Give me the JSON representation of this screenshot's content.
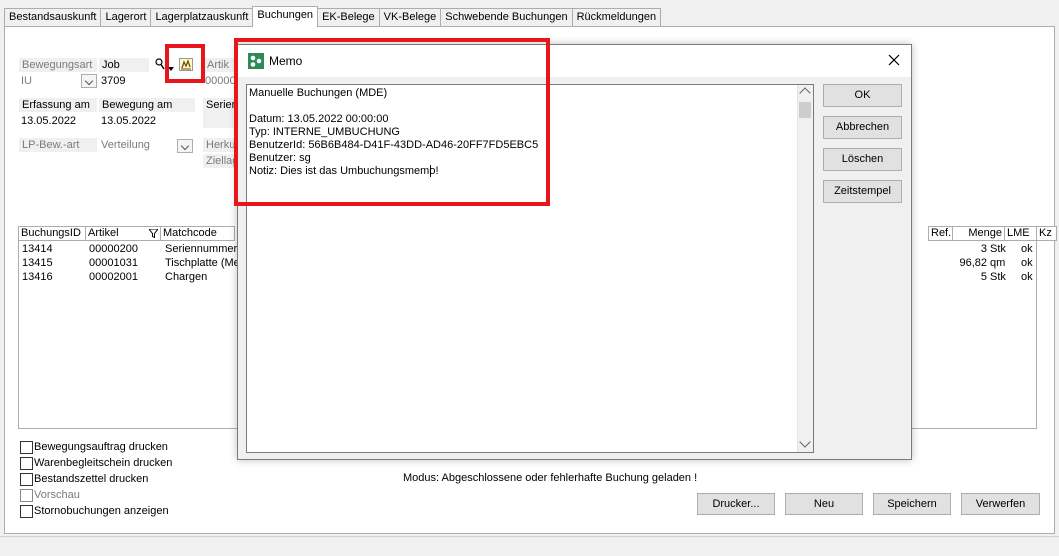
{
  "tabs": [
    "Bestandsauskunft",
    "Lagerort",
    "Lagerplatzauskunft",
    "Buchungen",
    "EK-Belege",
    "VK-Belege",
    "Schwebende Buchungen",
    "Rückmeldungen"
  ],
  "active_tab": "Buchungen",
  "form": {
    "bewegungsart_label": "Bewegungsart",
    "bewegungsart_value": "IU",
    "job_label": "Job",
    "job_value": "3709",
    "artikel_label": "Artik",
    "artikel_value": "00000",
    "erfassung_label": "Erfassung am",
    "erfassung_value": "13.05.2022",
    "bewegung_label": "Bewegung am",
    "bewegung_value": "13.05.2022",
    "serien_label": "Serien",
    "lpbew_label": "LP-Bew.-art",
    "lpbew_value": "Verteilung",
    "herkunft_label": "Herku",
    "ziellager_label": "Ziellag"
  },
  "table": {
    "headers": {
      "id": "BuchungsID",
      "artikel": "Artikel",
      "matchcode": "Matchcode",
      "ref": "Ref.",
      "menge": "Menge",
      "lme": "LME",
      "kz": "Kz"
    },
    "rows": [
      {
        "id": "13414",
        "artikel": "00000200",
        "matchcode": "Seriennummer",
        "menge": "3",
        "lme": "Stk",
        "kz": "ok"
      },
      {
        "id": "13415",
        "artikel": "00001031",
        "matchcode": "Tischplatte (Me",
        "menge": "96,82",
        "lme": "qm",
        "kz": "ok"
      },
      {
        "id": "13416",
        "artikel": "00002001",
        "matchcode": "Chargen",
        "menge": "5",
        "lme": "Stk",
        "kz": "ok"
      }
    ]
  },
  "checkboxes": [
    {
      "label": "Bewegungsauftrag drucken",
      "disabled": false
    },
    {
      "label": "Warenbegleitschein drucken",
      "disabled": false
    },
    {
      "label": "Bestandszettel drucken",
      "disabled": false
    },
    {
      "label": "Vorschau",
      "disabled": true
    },
    {
      "label": "Stornobuchungen anzeigen",
      "disabled": false
    }
  ],
  "modus_text": "Modus: Abgeschlossene oder fehlerhafte Buchung geladen !",
  "buttons": {
    "drucker": "Drucker...",
    "neu": "Neu",
    "speichern": "Speichern",
    "verwerfen": "Verwerfen"
  },
  "dialog": {
    "title": "Memo",
    "memo_lines": [
      "Manuelle Buchungen (MDE)",
      "",
      "Datum: 13.05.2022 00:00:00",
      "Typ: INTERNE_UMBUCHUNG",
      "BenutzerId: 56B6B484-D41F-43DD-AD46-20FF7FD5EBC5",
      "Benutzer: sg",
      "Notiz: Dies ist das Umbuchungsmemo!"
    ],
    "buttons": {
      "ok": "OK",
      "abbrechen": "Abbrechen",
      "loeschen": "Löschen",
      "zeitstempel": "Zeitstempel"
    }
  },
  "colors": {
    "highlight": "#e8151d",
    "icon_green": "#2e8b57"
  }
}
